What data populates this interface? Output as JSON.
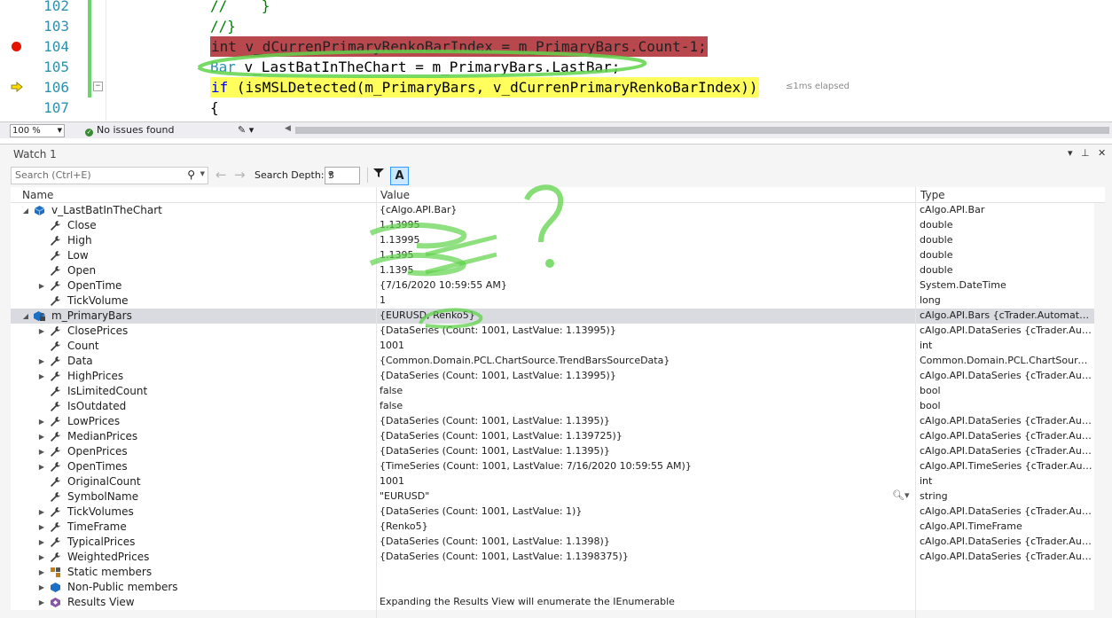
{
  "editor": {
    "lines": [
      {
        "num": "102",
        "text": "//    }"
      },
      {
        "num": "103",
        "text": "//}"
      },
      {
        "num": "104",
        "pre": "int",
        "text": " v_dCurrenPrimaryRenkoBarIndex = m_PrimaryBars.Count-1;"
      },
      {
        "num": "105",
        "pre": "Bar",
        "text": " v_LastBatInTheChart = m_PrimaryBars.LastBar;"
      },
      {
        "num": "106",
        "pre": "if",
        "text": " (isMSLDetected(m_PrimaryBars, v_dCurrenPrimaryRenkoBarIndex))"
      },
      {
        "num": "107",
        "text": "{"
      }
    ],
    "elapsed": "≤1ms elapsed",
    "zoom": "100 %",
    "issues": "No issues found"
  },
  "watch": {
    "title": "Watch 1",
    "search_placeholder": "Search (Ctrl+E)",
    "depth_label": "Search Depth:",
    "depth_value": "3",
    "col_name": "Name",
    "col_value": "Value",
    "col_type": "Type",
    "rows": [
      {
        "level": 0,
        "exp": "open",
        "icon": "object-icon",
        "name": "v_LastBatInTheChart",
        "value": "{cAlgo.API.Bar}",
        "type": "cAlgo.API.Bar"
      },
      {
        "level": 1,
        "exp": "",
        "icon": "property-icon",
        "name": "Close",
        "value": "1.13995",
        "type": "double"
      },
      {
        "level": 1,
        "exp": "",
        "icon": "property-icon",
        "name": "High",
        "value": "1.13995",
        "type": "double"
      },
      {
        "level": 1,
        "exp": "",
        "icon": "property-icon",
        "name": "Low",
        "value": "1.1395",
        "type": "double"
      },
      {
        "level": 1,
        "exp": "",
        "icon": "property-icon",
        "name": "Open",
        "value": "1.1395",
        "type": "double"
      },
      {
        "level": 1,
        "exp": "closed",
        "icon": "property-icon",
        "name": "OpenTime",
        "value": "{7/16/2020 10:59:55 AM}",
        "type": "System.DateTime"
      },
      {
        "level": 1,
        "exp": "",
        "icon": "property-icon",
        "name": "TickVolume",
        "value": "1",
        "type": "long"
      },
      {
        "level": 0,
        "exp": "open",
        "icon": "locked-object-icon",
        "name": "m_PrimaryBars",
        "value": "{EURUSD, Renko5}",
        "type": "cAlgo.API.Bars {cTrader.Automate.S...",
        "selected": true
      },
      {
        "level": 1,
        "exp": "closed",
        "icon": "property-icon",
        "name": "ClosePrices",
        "value": "{DataSeries (Count: 1001, LastValue: 1.13995)}",
        "type": "cAlgo.API.DataSeries {cTrader.Auto..."
      },
      {
        "level": 1,
        "exp": "",
        "icon": "property-icon",
        "name": "Count",
        "value": "1001",
        "type": "int"
      },
      {
        "level": 1,
        "exp": "closed",
        "icon": "property-icon",
        "name": "Data",
        "value": "{Common.Domain.PCL.ChartSource.TrendBarsSourceData}",
        "type": "Common.Domain.PCL.ChartSource..."
      },
      {
        "level": 1,
        "exp": "closed",
        "icon": "property-icon",
        "name": "HighPrices",
        "value": "{DataSeries (Count: 1001, LastValue: 1.13995)}",
        "type": "cAlgo.API.DataSeries {cTrader.Auto..."
      },
      {
        "level": 1,
        "exp": "",
        "icon": "property-icon",
        "name": "IsLimitedCount",
        "value": "false",
        "type": "bool"
      },
      {
        "level": 1,
        "exp": "",
        "icon": "property-icon",
        "name": "IsOutdated",
        "value": "false",
        "type": "bool"
      },
      {
        "level": 1,
        "exp": "closed",
        "icon": "property-icon",
        "name": "LowPrices",
        "value": "{DataSeries (Count: 1001, LastValue: 1.1395)}",
        "type": "cAlgo.API.DataSeries {cTrader.Auto..."
      },
      {
        "level": 1,
        "exp": "closed",
        "icon": "property-icon",
        "name": "MedianPrices",
        "value": "{DataSeries (Count: 1001, LastValue: 1.139725)}",
        "type": "cAlgo.API.DataSeries {cTrader.Auto..."
      },
      {
        "level": 1,
        "exp": "closed",
        "icon": "property-icon",
        "name": "OpenPrices",
        "value": "{DataSeries (Count: 1001, LastValue: 1.1395)}",
        "type": "cAlgo.API.DataSeries {cTrader.Auto..."
      },
      {
        "level": 1,
        "exp": "closed",
        "icon": "property-icon",
        "name": "OpenTimes",
        "value": "{TimeSeries (Count: 1001, LastValue: 7/16/2020 10:59:55 AM)}",
        "type": "cAlgo.API.TimeSeries {cTrader.Auto..."
      },
      {
        "level": 1,
        "exp": "",
        "icon": "property-icon",
        "name": "OriginalCount",
        "value": "1001",
        "type": "int"
      },
      {
        "level": 1,
        "exp": "",
        "icon": "property-icon",
        "name": "SymbolName",
        "value": "\"EURUSD\"",
        "type": "string",
        "visualizer": true
      },
      {
        "level": 1,
        "exp": "closed",
        "icon": "property-icon",
        "name": "TickVolumes",
        "value": "{DataSeries (Count: 1001, LastValue: 1)}",
        "type": "cAlgo.API.DataSeries {cTrader.Auto..."
      },
      {
        "level": 1,
        "exp": "closed",
        "icon": "property-icon",
        "name": "TimeFrame",
        "value": "{Renko5}",
        "type": "cAlgo.API.TimeFrame"
      },
      {
        "level": 1,
        "exp": "closed",
        "icon": "property-icon",
        "name": "TypicalPrices",
        "value": "{DataSeries (Count: 1001, LastValue: 1.1398)}",
        "type": "cAlgo.API.DataSeries {cTrader.Auto..."
      },
      {
        "level": 1,
        "exp": "closed",
        "icon": "property-icon",
        "name": "WeightedPrices",
        "value": "{DataSeries (Count: 1001, LastValue: 1.1398375)}",
        "type": "cAlgo.API.DataSeries {cTrader.Auto..."
      },
      {
        "level": 1,
        "exp": "closed",
        "icon": "static-members-icon",
        "name": "Static members",
        "value": "",
        "type": ""
      },
      {
        "level": 1,
        "exp": "closed",
        "icon": "non-public-icon",
        "name": "Non-Public members",
        "value": "",
        "type": ""
      },
      {
        "level": 1,
        "exp": "closed",
        "icon": "results-view-icon",
        "name": "Results View",
        "value": "Expanding the Results View will enumerate the IEnumerable",
        "type": ""
      }
    ]
  },
  "colors": {
    "breakpoint": "#e51400",
    "selection": "#dadbe1",
    "annotation_green": "#5fd34a"
  }
}
